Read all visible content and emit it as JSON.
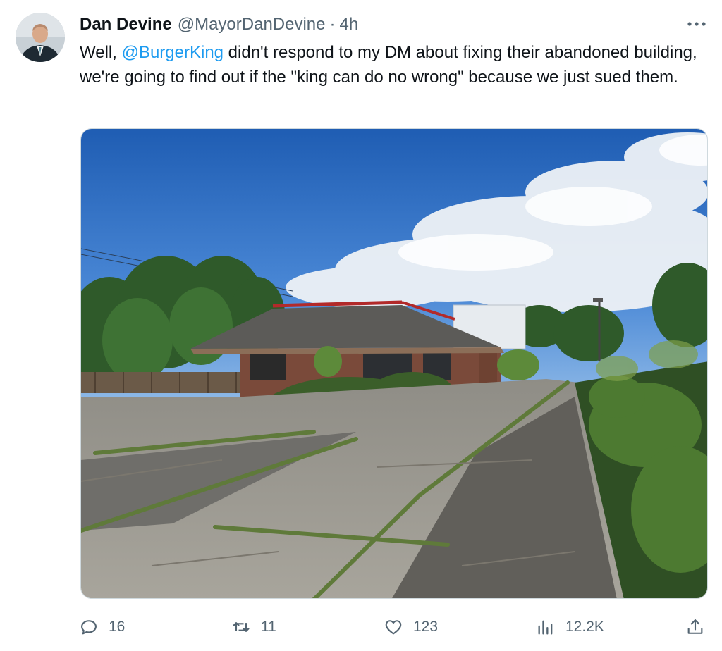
{
  "author": {
    "name": "Dan Devine",
    "handle": "@MayorDanDevine",
    "separator": "·",
    "time": "4h"
  },
  "tweet": {
    "text_before": "Well, ",
    "mention": "@BurgerKing",
    "text_after": " didn't respond to my DM about fixing their abandoned building, we're going to find out if the \"king can do no wrong\" because we just sued them."
  },
  "more_icon": "more-horizontal-icon",
  "actions": {
    "reply": {
      "icon": "reply-icon",
      "count": "16"
    },
    "retweet": {
      "icon": "retweet-icon",
      "count": "11"
    },
    "like": {
      "icon": "heart-icon",
      "count": "123"
    },
    "views": {
      "icon": "views-icon",
      "count": "12.2K"
    },
    "share": {
      "icon": "share-icon"
    }
  },
  "colors": {
    "text": "#0f1419",
    "secondary": "#536471",
    "link": "#1d9bf0"
  }
}
